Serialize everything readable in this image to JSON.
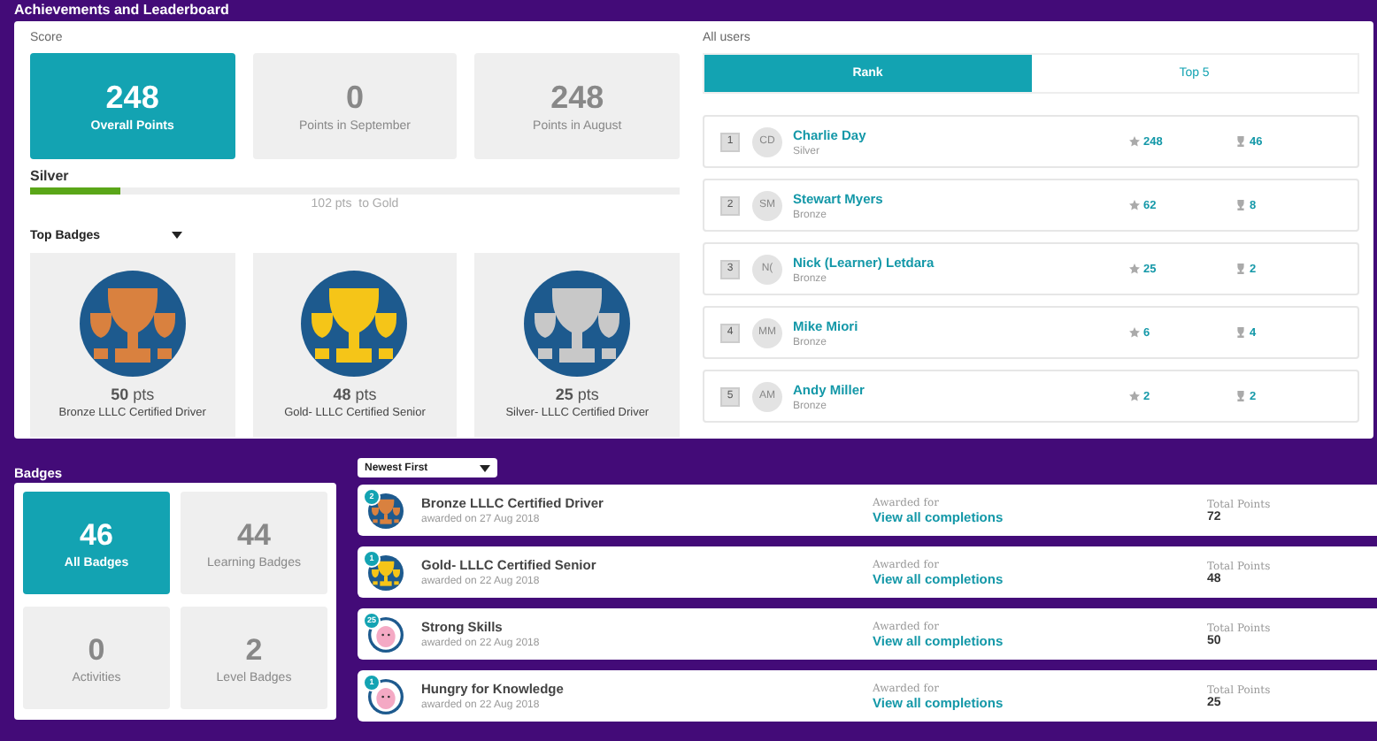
{
  "title": "Achievements and Leaderboard",
  "score": {
    "label": "Score",
    "tiles": [
      {
        "value": "248",
        "label": "Overall Points",
        "selected": true
      },
      {
        "value": "0",
        "label": "Points in September",
        "selected": false
      },
      {
        "value": "248",
        "label": "Points in August",
        "selected": false
      }
    ],
    "level_name": "Silver",
    "level": 0.14,
    "progress_text": "102 pts  to Gold"
  },
  "top_badges": {
    "label": "Top Badges",
    "items": [
      {
        "points": "**50** pts",
        "name": "Bronze LLLC Certified Driver",
        "color": "#d9813f"
      },
      {
        "points": "**48** pts",
        "name": "Gold- LLLC Certified Senior",
        "color": "#f5c518"
      },
      {
        "points": "**25** pts",
        "name": "Silver- LLLC Certified Driver",
        "color": "#c8c8c8"
      }
    ]
  },
  "leaderboard": {
    "label": "All users",
    "tabs": [
      {
        "label": "Rank",
        "selected": true
      },
      {
        "label": "Top 5",
        "selected": false
      }
    ],
    "rows": [
      {
        "rank": "1",
        "initials": "CD",
        "name": "Charlie Day",
        "level": "Silver",
        "points": "248",
        "badges": "46"
      },
      {
        "rank": "2",
        "initials": "SM",
        "name": "Stewart Myers",
        "level": "Bronze",
        "points": "62",
        "badges": "8"
      },
      {
        "rank": "3",
        "initials": "N(",
        "name": "Nick (Learner) Letdara",
        "level": "Bronze",
        "points": "25",
        "badges": "2"
      },
      {
        "rank": "4",
        "initials": "MM",
        "name": "Mike Miori",
        "level": "Bronze",
        "points": "6",
        "badges": "4"
      },
      {
        "rank": "5",
        "initials": "AM",
        "name": "Andy Miller",
        "level": "Bronze",
        "points": "2",
        "badges": "2"
      }
    ]
  },
  "badges": {
    "title": "Badges",
    "tiles": [
      {
        "value": "46",
        "label": "All Badges",
        "selected": true
      },
      {
        "value": "44",
        "label": "Learning Badges",
        "selected": false
      },
      {
        "value": "0",
        "label": "Activities",
        "selected": false
      },
      {
        "value": "2",
        "label": "Level Badges",
        "selected": false
      }
    ],
    "sort": "Newest First",
    "list": [
      {
        "kind": "trophy",
        "color": "#d9813f",
        "count": "2",
        "name": "Bronze LLLC Certified Driver",
        "date": "awarded on 27 Aug 2018",
        "awarded_label": "Awarded for",
        "link": "View all completions",
        "points_label": "Total Points",
        "points": "72"
      },
      {
        "kind": "trophy",
        "color": "#f5c518",
        "count": "1",
        "name": "Gold- LLLC Certified Senior",
        "date": "awarded on 22 Aug 2018",
        "awarded_label": "Awarded for",
        "link": "View all completions",
        "points_label": "Total Points",
        "points": "48"
      },
      {
        "kind": "creature",
        "color": "#f4a9c4",
        "count": "25",
        "name": "Strong Skills",
        "date": "awarded on 22 Aug 2018",
        "awarded_label": "Awarded for",
        "link": "View all completions",
        "points_label": "Total Points",
        "points": "50"
      },
      {
        "kind": "creature",
        "color": "#f4a9c4",
        "count": "1",
        "name": "Hungry for Knowledge",
        "date": "awarded on 22 Aug 2018",
        "awarded_label": "Awarded for",
        "link": "View all completions",
        "points_label": "Total Points",
        "points": "25"
      }
    ]
  }
}
